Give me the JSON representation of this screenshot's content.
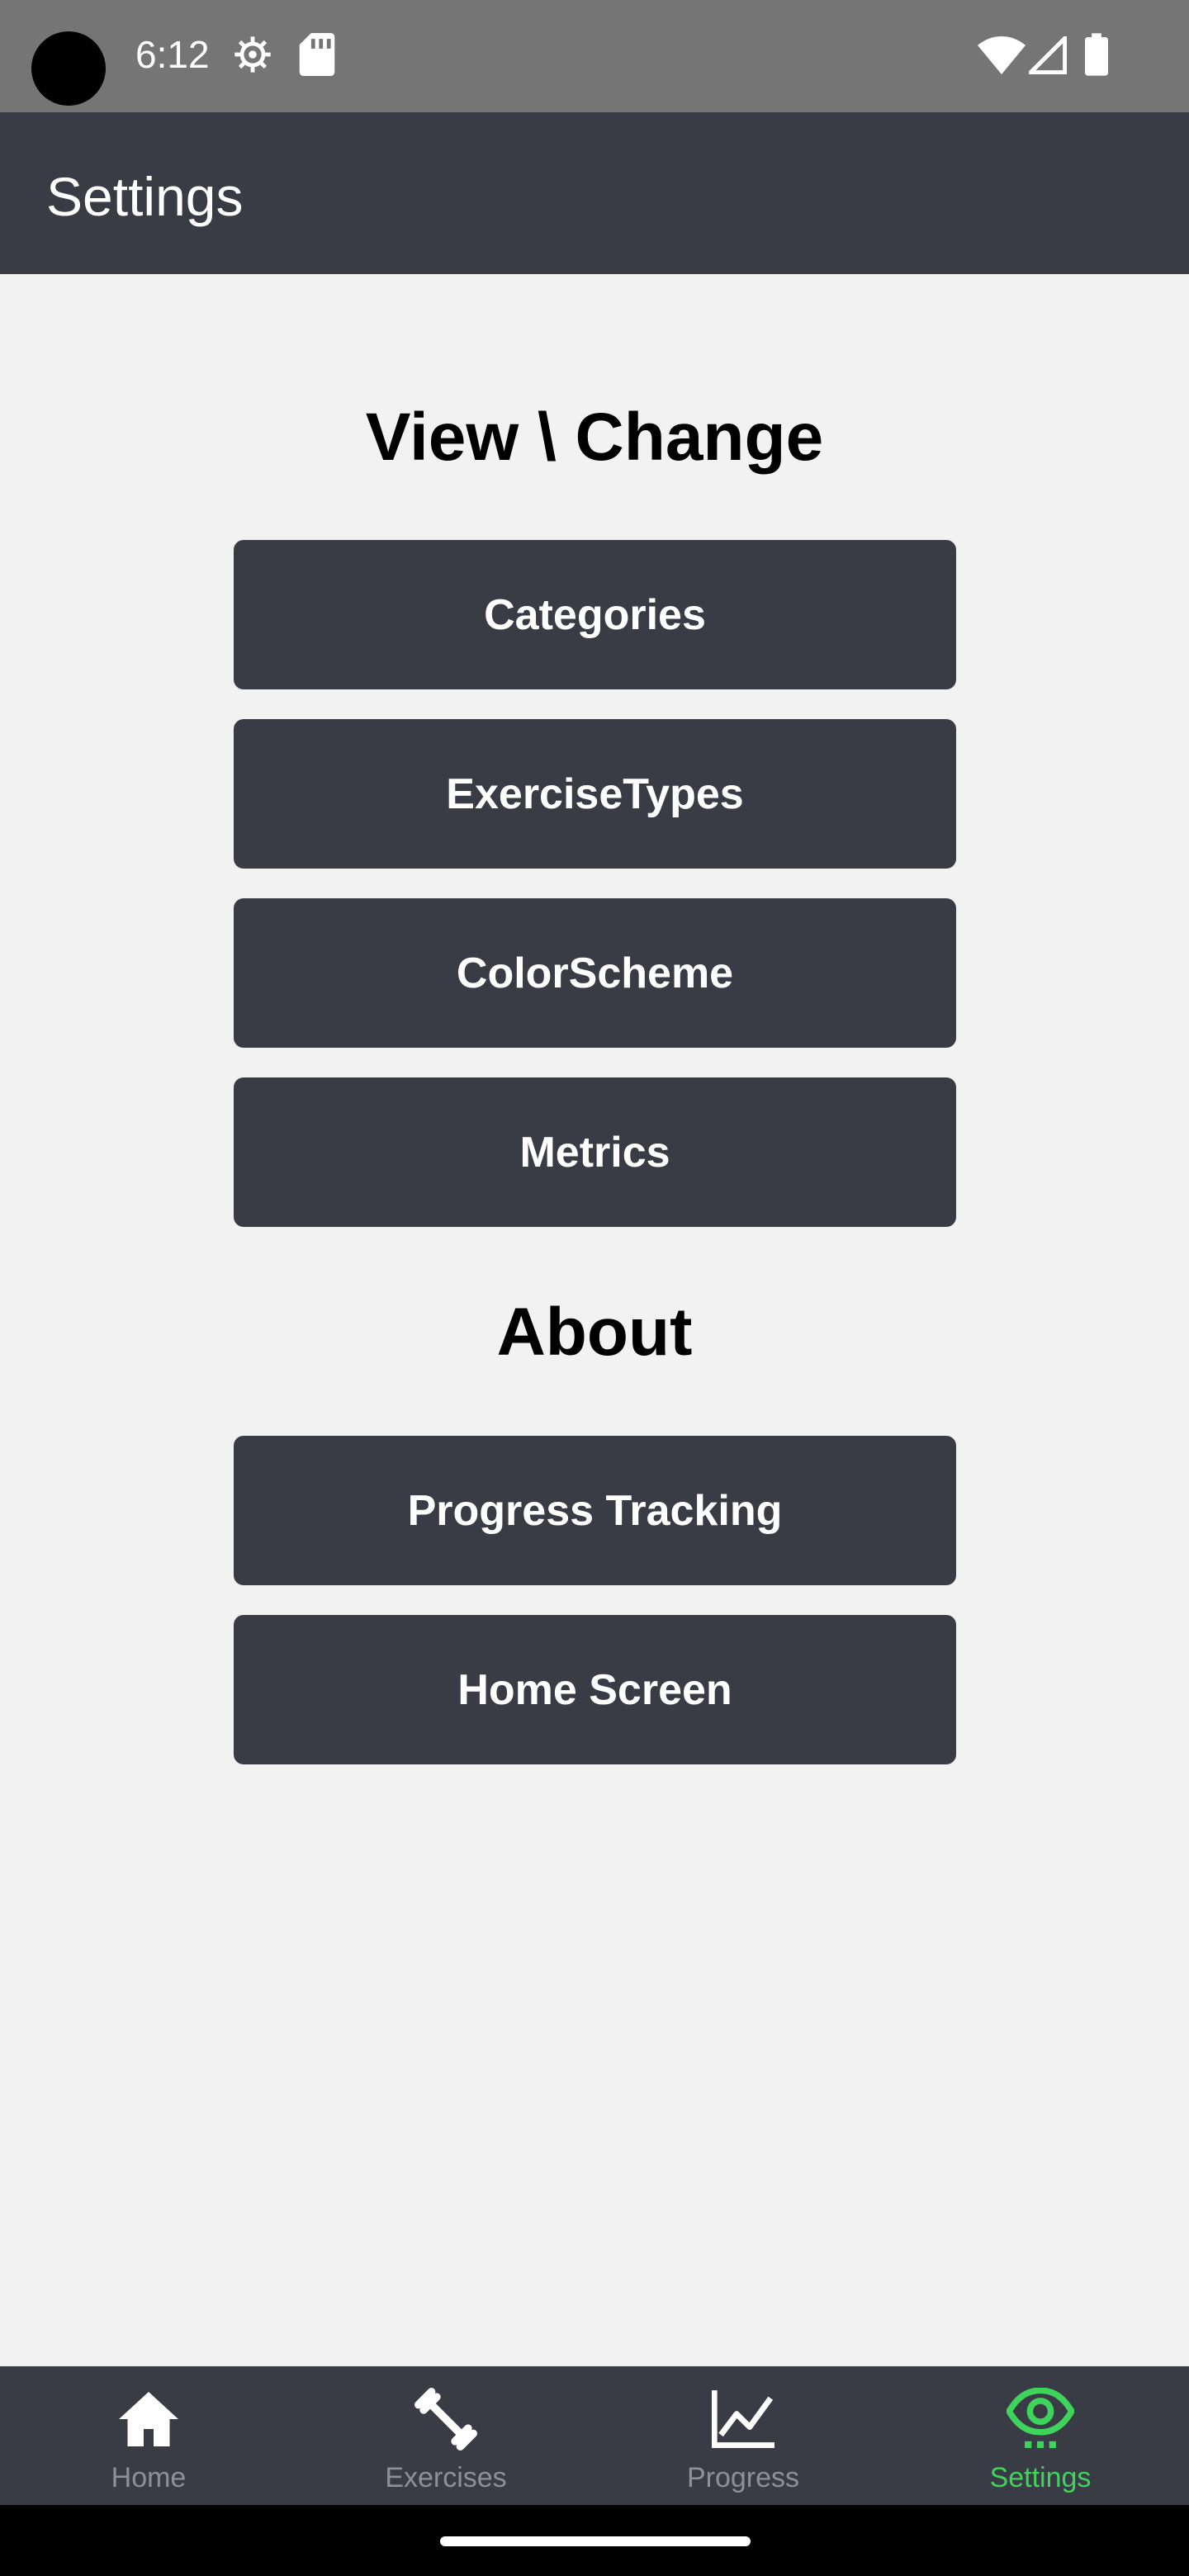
{
  "status_bar": {
    "time": "6:12",
    "left_icons": [
      "settings-gear-icon",
      "sd-card-icon"
    ],
    "right_icons": [
      "wifi-icon",
      "cellular-signal-icon",
      "battery-icon"
    ]
  },
  "app_bar": {
    "title": "Settings"
  },
  "sections": {
    "view_change": {
      "heading": "View \\ Change",
      "buttons": [
        "Categories",
        "ExerciseTypes",
        "ColorScheme",
        "Metrics"
      ]
    },
    "about": {
      "heading": "About",
      "buttons": [
        "Progress Tracking",
        "Home Screen"
      ]
    }
  },
  "bottom_nav": {
    "items": [
      {
        "label": "Home",
        "icon": "home-icon",
        "active": false
      },
      {
        "label": "Exercises",
        "icon": "dumbbell-icon",
        "active": false
      },
      {
        "label": "Progress",
        "icon": "line-chart-icon",
        "active": false
      },
      {
        "label": "Settings",
        "icon": "eye-icon",
        "active": true
      }
    ]
  },
  "colors": {
    "status_bar": "#757575",
    "app_bar": "#393c45",
    "background": "#f2f2f2",
    "button": "#393c45",
    "nav_inactive": "#8d9096",
    "nav_active": "#3ed35a"
  }
}
